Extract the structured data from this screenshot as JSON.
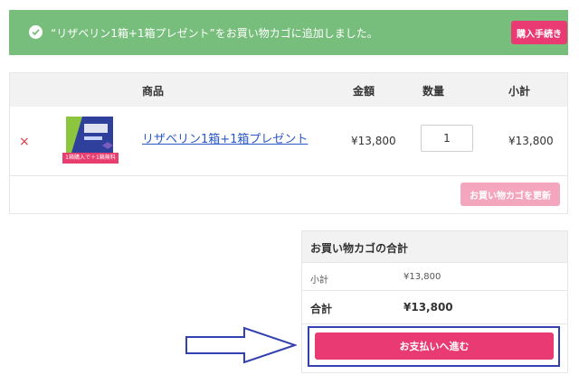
{
  "notice": {
    "message": "“リザベリン1箱+1箱プレゼント”をお買い物カゴに追加しました。",
    "proceed_label": "購入手続き"
  },
  "cart_table": {
    "columns": {
      "product": "商品",
      "price": "金額",
      "quantity": "数量",
      "subtotal": "小計"
    },
    "items": [
      {
        "remove_icon": "×",
        "thumbnail_badge": "1箱購入で＋1箱無料",
        "name": "リザベリン1箱+1箱プレゼント",
        "price": "¥13,800",
        "quantity": "1",
        "subtotal": "¥13,800"
      }
    ],
    "update_label": "お買い物カゴを更新"
  },
  "cart_totals": {
    "title": "お買い物カゴの合計",
    "subtotal_label": "小計",
    "subtotal_value": "¥13,800",
    "total_label": "合計",
    "total_value": "¥13,800",
    "checkout_label": "お支払いへ進む"
  },
  "colors": {
    "notice_bg": "#77bd7b",
    "accent": "#ea3a74",
    "highlight": "#3340b0"
  }
}
